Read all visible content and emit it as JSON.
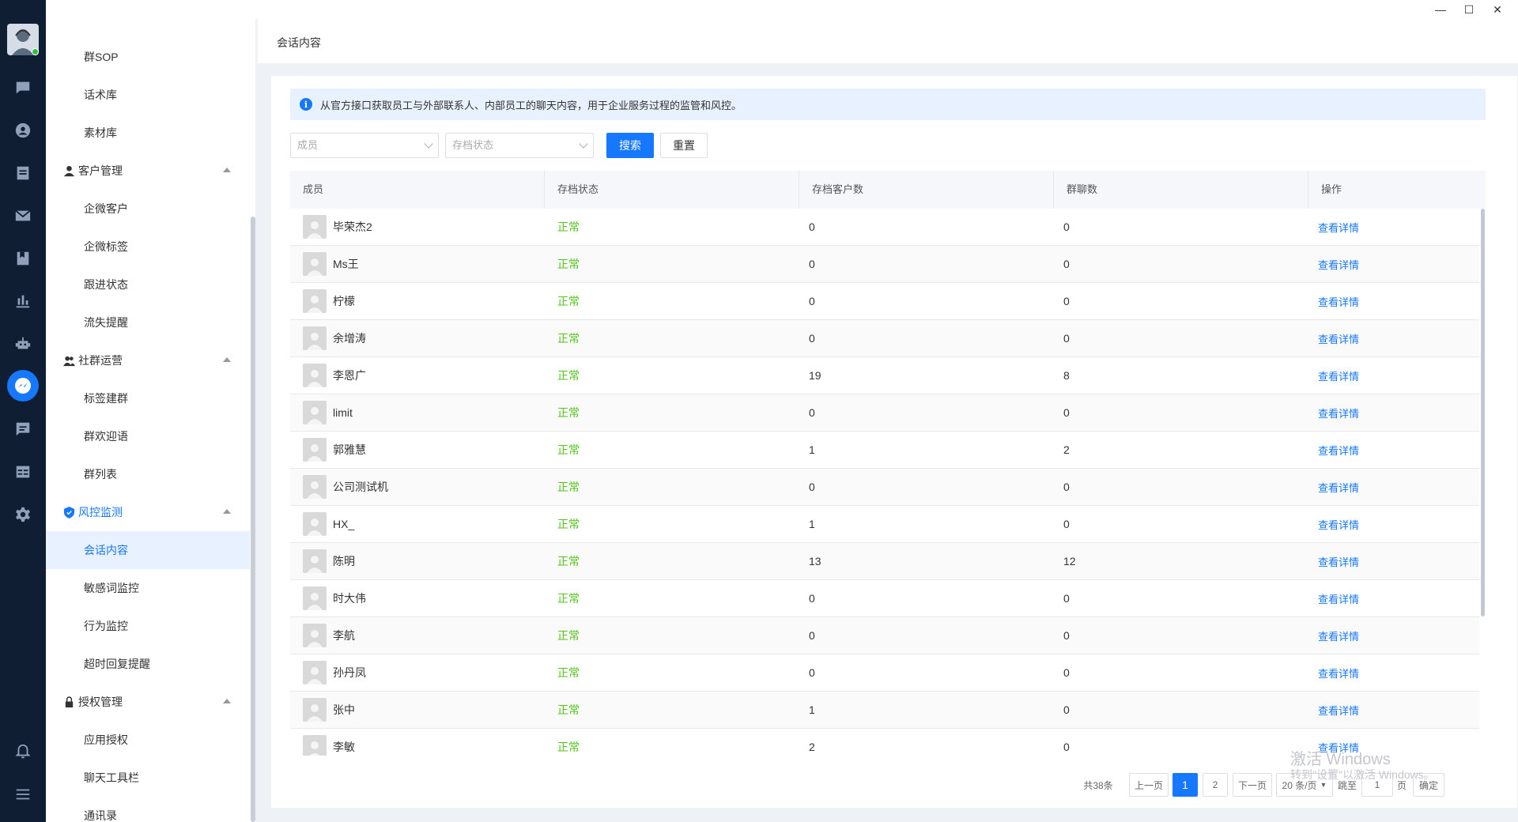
{
  "window": {
    "minimize": "—",
    "maximize": "☐",
    "close": "✕"
  },
  "sidebar": {
    "items": [
      {
        "label": "群SOP",
        "type": "sub"
      },
      {
        "label": "话术库",
        "type": "sub"
      },
      {
        "label": "素材库",
        "type": "sub"
      },
      {
        "label": "客户管理",
        "type": "group",
        "icon": "user-icon"
      },
      {
        "label": "企微客户",
        "type": "sub"
      },
      {
        "label": "企微标签",
        "type": "sub"
      },
      {
        "label": "跟进状态",
        "type": "sub"
      },
      {
        "label": "流失提醒",
        "type": "sub"
      },
      {
        "label": "社群运营",
        "type": "group",
        "icon": "group-icon"
      },
      {
        "label": "标签建群",
        "type": "sub"
      },
      {
        "label": "群欢迎语",
        "type": "sub"
      },
      {
        "label": "群列表",
        "type": "sub"
      },
      {
        "label": "风控监测",
        "type": "group",
        "icon": "shield-icon",
        "active": true
      },
      {
        "label": "会话内容",
        "type": "sub",
        "active": true
      },
      {
        "label": "敏感词监控",
        "type": "sub"
      },
      {
        "label": "行为监控",
        "type": "sub"
      },
      {
        "label": "超时回复提醒",
        "type": "sub"
      },
      {
        "label": "授权管理",
        "type": "group",
        "icon": "lock-icon"
      },
      {
        "label": "应用授权",
        "type": "sub"
      },
      {
        "label": "聊天工具栏",
        "type": "sub"
      },
      {
        "label": "通讯录",
        "type": "sub"
      }
    ]
  },
  "page": {
    "title": "会话内容",
    "alert": "从官方接口获取员工与外部联系人、内部员工的聊天内容，用于企业服务过程的监管和风控。",
    "alert_icon": "i"
  },
  "filters": {
    "member_placeholder": "成员",
    "status_placeholder": "存档状态",
    "search_label": "搜索",
    "reset_label": "重置"
  },
  "table": {
    "headers": [
      "成员",
      "存档状态",
      "存档客户数",
      "群聊数",
      "操作"
    ],
    "rows": [
      {
        "name": "毕荣杰2",
        "status": "正常",
        "customers": "0",
        "groups": "0",
        "action": "查看详情"
      },
      {
        "name": "Ms王",
        "status": "正常",
        "customers": "0",
        "groups": "0",
        "action": "查看详情"
      },
      {
        "name": "柠檬",
        "status": "正常",
        "customers": "0",
        "groups": "0",
        "action": "查看详情"
      },
      {
        "name": "余增涛",
        "status": "正常",
        "customers": "0",
        "groups": "0",
        "action": "查看详情"
      },
      {
        "name": "李恩广",
        "status": "正常",
        "customers": "19",
        "groups": "8",
        "action": "查看详情"
      },
      {
        "name": "limit",
        "status": "正常",
        "customers": "0",
        "groups": "0",
        "action": "查看详情"
      },
      {
        "name": "郭雅慧",
        "status": "正常",
        "customers": "1",
        "groups": "2",
        "action": "查看详情"
      },
      {
        "name": "公司测试机",
        "status": "正常",
        "customers": "0",
        "groups": "0",
        "action": "查看详情"
      },
      {
        "name": "HX_",
        "status": "正常",
        "customers": "1",
        "groups": "0",
        "action": "查看详情"
      },
      {
        "name": "陈明",
        "status": "正常",
        "customers": "13",
        "groups": "12",
        "action": "查看详情"
      },
      {
        "name": "时大伟",
        "status": "正常",
        "customers": "0",
        "groups": "0",
        "action": "查看详情"
      },
      {
        "name": "李航",
        "status": "正常",
        "customers": "0",
        "groups": "0",
        "action": "查看详情"
      },
      {
        "name": "孙丹凤",
        "status": "正常",
        "customers": "0",
        "groups": "0",
        "action": "查看详情"
      },
      {
        "name": "张中",
        "status": "正常",
        "customers": "1",
        "groups": "0",
        "action": "查看详情"
      },
      {
        "name": "李敏",
        "status": "正常",
        "customers": "2",
        "groups": "0",
        "action": "查看详情"
      }
    ]
  },
  "pagination": {
    "total": "共38条",
    "prev": "上一页",
    "pages": [
      "1",
      "2"
    ],
    "current": "1",
    "next": "下一页",
    "page_size": "20 条/页",
    "jump_label": "跳至",
    "jump_value": "1",
    "page_unit": "页",
    "confirm": "确定"
  },
  "watermark": {
    "line1": "激活 Windows",
    "line2": "转到\"设置\"以激活 Windows。"
  },
  "colors": {
    "primary": "#1677ff",
    "success": "#52c41a",
    "rail": "#0f1e33"
  }
}
